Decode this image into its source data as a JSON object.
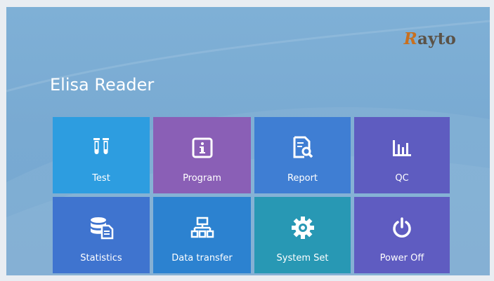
{
  "app": {
    "brand": "Rayto",
    "title": "Elisa Reader"
  },
  "menu": [
    {
      "label": "Test",
      "icon": "test-tubes-icon",
      "color": "#2d9de0"
    },
    {
      "label": "Program",
      "icon": "info-icon",
      "color": "#8a5fb6"
    },
    {
      "label": "Report",
      "icon": "report-search-icon",
      "color": "#3f7ed3"
    },
    {
      "label": "QC",
      "icon": "bar-chart-icon",
      "color": "#5e5cc0"
    },
    {
      "label": "Statistics",
      "icon": "database-icon",
      "color": "#3f74cf"
    },
    {
      "label": "Data transfer",
      "icon": "network-icon",
      "color": "#2c82d0"
    },
    {
      "label": "System Set",
      "icon": "gear-icon",
      "color": "#2898b4"
    },
    {
      "label": "Power Off",
      "icon": "power-icon",
      "color": "#5f5cc1"
    }
  ]
}
